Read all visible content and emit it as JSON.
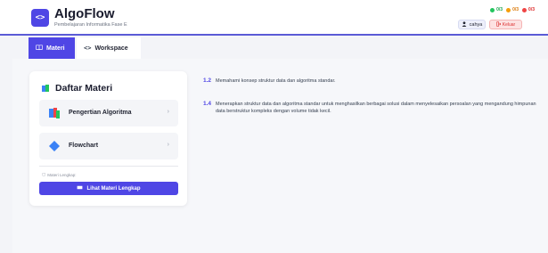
{
  "header": {
    "logo_glyph": "<>",
    "title": "AlgoFlow",
    "subtitle": "Pembelajaran Informatika Fase E",
    "stats": [
      {
        "value": "0/3",
        "color": "#22c55e"
      },
      {
        "value": "0/3",
        "color": "#f59e0b"
      },
      {
        "value": "0/3",
        "color": "#ef4444"
      }
    ],
    "user_icon": "user-icon",
    "user_name": "cahya",
    "logout_label": "Keluar",
    "logout_icon": "logout-icon"
  },
  "tabs": [
    {
      "label": "Materi",
      "icon": "book-icon",
      "active": true
    },
    {
      "label": "Workspace",
      "icon": "code-icon",
      "active": false
    }
  ],
  "panel": {
    "title": "Daftar Materi",
    "items": [
      {
        "label": "Pengertian Algoritma",
        "icon": "algorithm-icon"
      },
      {
        "label": "Flowchart",
        "icon": "diamond-icon"
      }
    ],
    "complete_label": "Materi Lengkap:",
    "complete_button": "Lihat Materi Lengkap"
  },
  "objectives": [
    {
      "number": "1.2",
      "text": "Memahami konsep struktur data dan algoritma standar."
    },
    {
      "number": "1.4",
      "text": "Menerapkan struktur data dan algoritma standar untuk menghasilkan berbagai solusi dalam menyelesaikan persoalan yang mengandung himpunan data berstruktur kompleks dengan volume tidak kecil."
    }
  ],
  "colors": {
    "accent": "#4f46e5",
    "danger": "#ef4444"
  }
}
